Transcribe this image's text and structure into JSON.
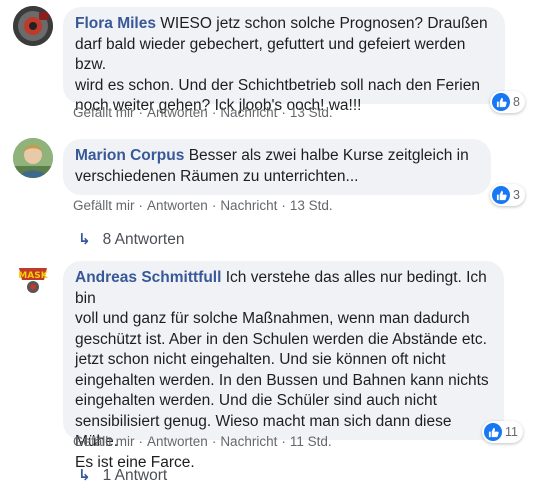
{
  "comments": [
    {
      "author": "Flora Miles",
      "text_lines": [
        "WIESO jetz schon solche Prognosen? Draußen",
        "darf bald wieder gebechert, gefuttert und gefeiert werden bzw.",
        "wird es schon. Und der Schichtbetrieb soll nach den Ferien",
        "noch weiter gehen? Ick jloob's ooch! wa!!!"
      ],
      "like_label": "Gefällt mir",
      "reply_label": "Antworten",
      "message_label": "Nachricht",
      "time": "13 Std.",
      "reactions": "8"
    },
    {
      "author": "Marion Corpus",
      "text_lines": [
        "Besser als zwei halbe Kurse zeitgleich in",
        "verschiedenen Räumen zu unterrichten..."
      ],
      "like_label": "Gefällt mir",
      "reply_label": "Antworten",
      "message_label": "Nachricht",
      "time": "13 Std.",
      "reactions": "3",
      "replies_label": "8 Antworten"
    },
    {
      "author": "Andreas Schmittfull",
      "text_lines": [
        "Ich verstehe das alles nur bedingt. Ich bin",
        "voll und ganz für solche Maßnahmen, wenn man dadurch",
        "geschützt ist. Aber in den Schulen werden die Abstände etc.",
        "jetzt schon nicht eingehalten. Und sie können oft nicht",
        "eingehalten werden. In den Bussen und Bahnen kann nichts",
        "eingehalten werden. Und die Schüler sind auch nicht",
        "sensibilisiert genug. Wieso macht man sich dann diese Mühe.",
        "Es ist eine Farce."
      ],
      "like_label": "Gefällt mir",
      "reply_label": "Antworten",
      "message_label": "Nachricht",
      "time": "11 Std.",
      "reactions": "11",
      "replies_label": "1 Antwort",
      "avatar_text": "MASK"
    }
  ],
  "colors": {
    "author": "#385898",
    "bubble": "#f0f2f5",
    "muted": "#65676b",
    "like": "#1877f2"
  },
  "icons": [
    "avatar-photo",
    "like-thumb-icon",
    "reply-arrow-icon"
  ]
}
